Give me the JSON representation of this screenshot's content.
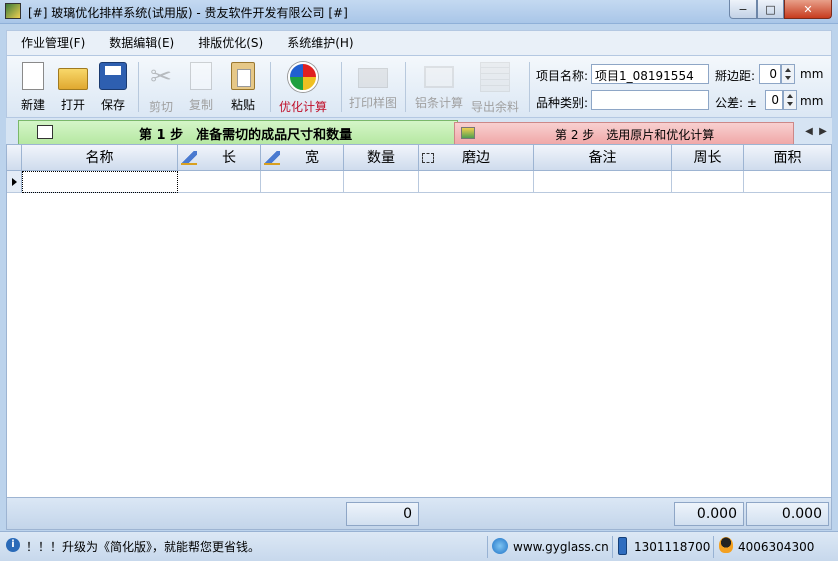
{
  "window": {
    "title": "[#] 玻璃优化排样系统(试用版) - 贵友软件开发有限公司 [#]",
    "min_glyph": "−",
    "max_glyph": "□",
    "close_glyph": "✕"
  },
  "menu": [
    "作业管理(F)",
    "数据编辑(E)",
    "排版优化(S)",
    "系统维护(H)"
  ],
  "toolbar": {
    "new": "新建",
    "open": "打开",
    "save": "保存",
    "cut": "剪切",
    "copy": "复制",
    "paste": "粘贴",
    "optimize": "优化计算",
    "print": "打印样图",
    "aluminum": "铝条计算",
    "export": "导出余料",
    "project_name_label": "项目名称:",
    "project_name_value": "项目1_08191554",
    "category_label": "品种类别:",
    "category_value": "",
    "edge_label": "掰边距:",
    "edge_value": "0",
    "edge_unit": "mm",
    "tolerance_label": "公差: ±",
    "tolerance_value": "0",
    "tolerance_unit": "mm"
  },
  "tabs": {
    "step1": "第 1 步　准备需切的成品尺寸和数量",
    "step2": "第 2 步　选用原片和优化计算",
    "left_arrow": "◀",
    "right_arrow": "▶"
  },
  "grid": {
    "columns": [
      "名称",
      "长",
      "宽",
      "数量",
      "磨边",
      "备注",
      "周长",
      "面积"
    ]
  },
  "totals": {
    "quantity": "0",
    "perimeter": "0.000",
    "area": "0.000"
  },
  "status": {
    "info_glyph": "i",
    "message": "！！！升级为《简化版》，就能帮您更省钱。",
    "website": "www.gyglass.cn",
    "phone": "1301118700",
    "qq": "4006304300"
  },
  "colors": {
    "tab1_bg": "#c6efb4",
    "tab2_bg": "#f4bcbc",
    "optimize_label": "#c0102a"
  }
}
